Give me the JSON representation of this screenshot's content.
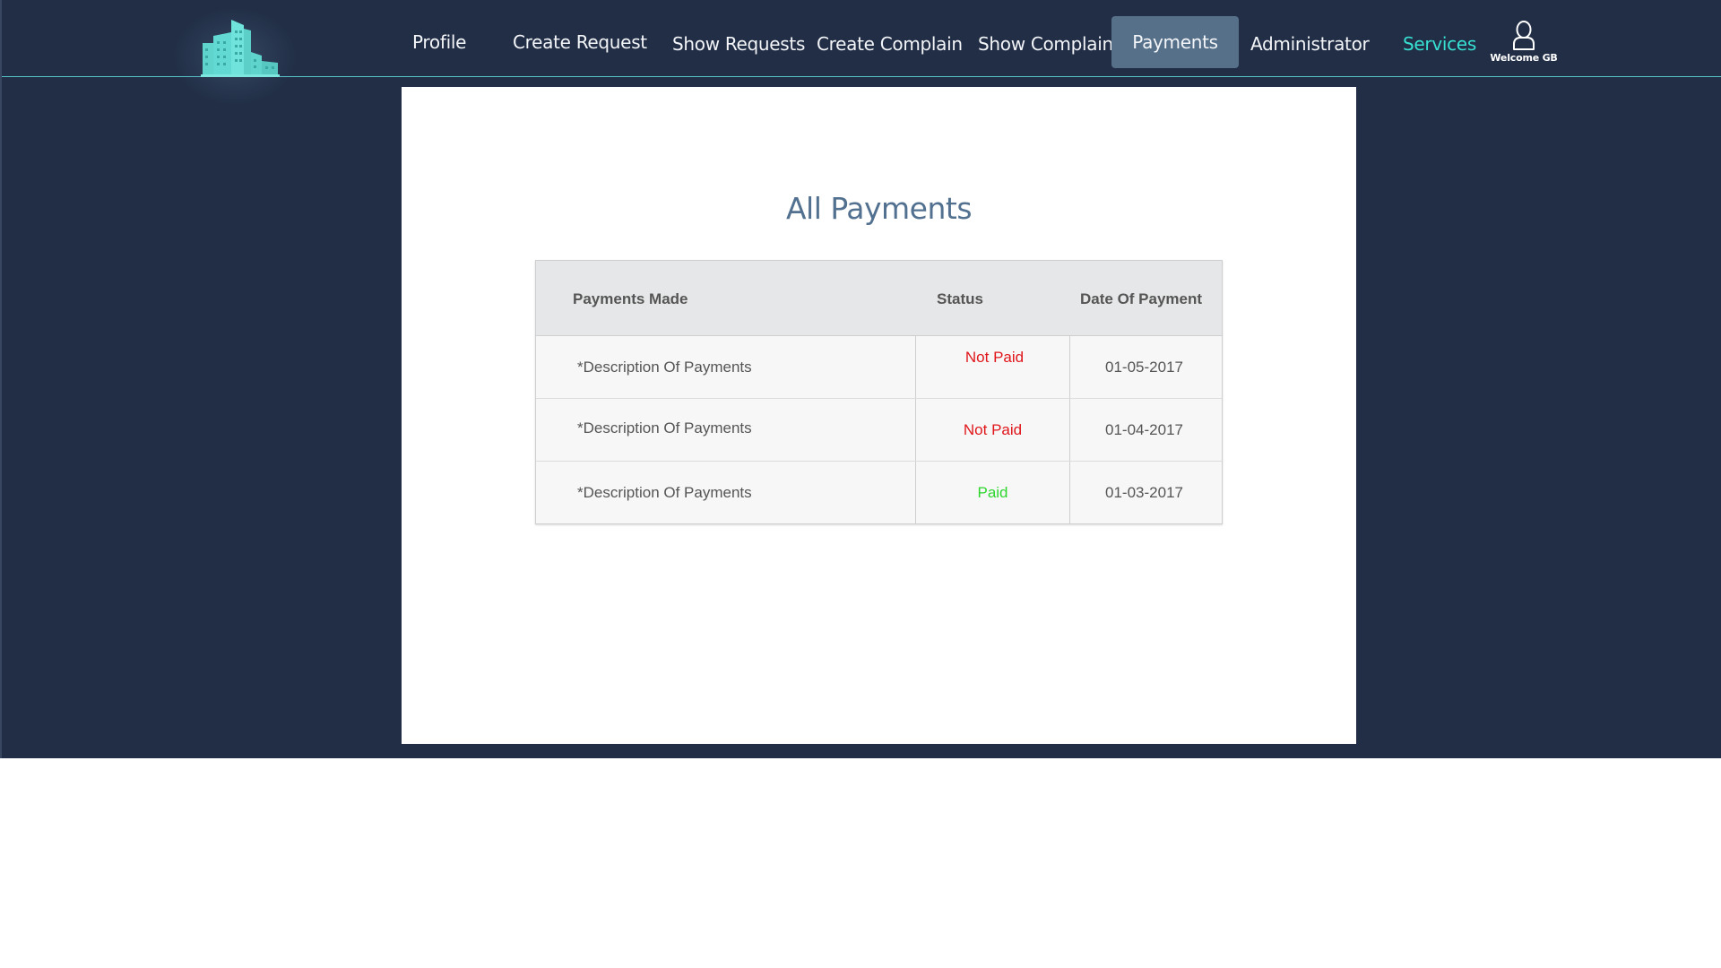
{
  "nav": {
    "items": [
      {
        "label": "Profile"
      },
      {
        "label": "Create Request"
      },
      {
        "label": "Show Requests"
      },
      {
        "label": "Create Complain"
      },
      {
        "label": "Show Complains"
      },
      {
        "label": "Payments"
      },
      {
        "label": "Administrator"
      },
      {
        "label": "Services"
      }
    ],
    "active": "Payments",
    "user_label": "Welcome GB"
  },
  "colors": {
    "background": "#212e46",
    "accent": "#37e0d2",
    "active_tab": "#56708a",
    "title": "#52708f",
    "not_paid": "#e0161b",
    "paid": "#2ed62e"
  },
  "icons": {
    "logo": "buildings-logo-icon",
    "user": "user-icon"
  },
  "page": {
    "title": "All Payments"
  },
  "table": {
    "headers": [
      "Payments Made",
      "Status",
      "Date Of Payment"
    ],
    "rows": [
      {
        "description": "*Description Of Payments",
        "status": "Not Paid",
        "date": "01-05-2017"
      },
      {
        "description": "*Description Of Payments",
        "status": "Not Paid",
        "date": "01-04-2017"
      },
      {
        "description": "*Description Of Payments",
        "status": "Paid",
        "date": "01-03-2017"
      }
    ]
  }
}
